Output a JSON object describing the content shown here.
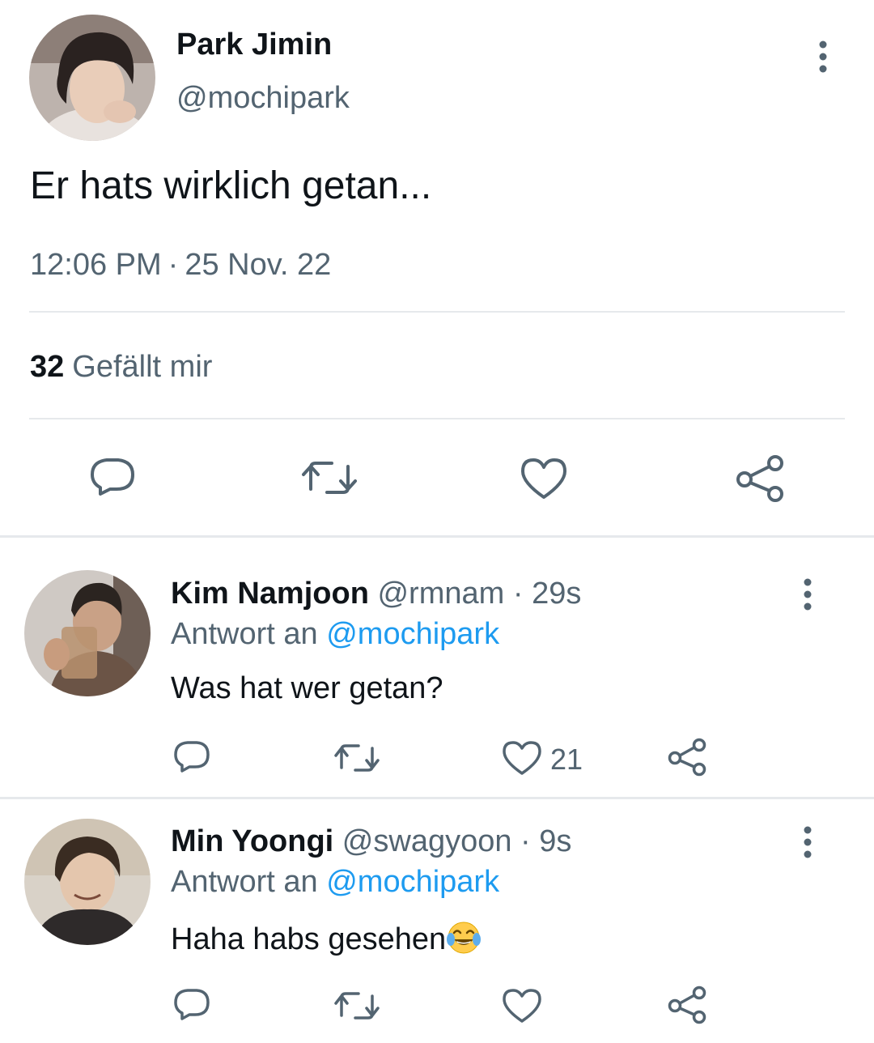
{
  "tweet": {
    "author_name": "Park Jimin",
    "author_handle": "@mochipark",
    "text": "Er hats wirklich getan...",
    "time": "12:06 PM",
    "separator": "·",
    "date": "25 Nov. 22",
    "likes_count": "32",
    "likes_label": "Gefällt mir",
    "actions": [
      "reply-icon",
      "retweet-icon",
      "like-icon",
      "share-icon"
    ]
  },
  "replies": [
    {
      "name": "Kim Namjoon",
      "handle": "@rmnam",
      "sep": "·",
      "time": "29s",
      "reply_prefix": "Antwort an",
      "reply_to": "@mochipark",
      "text": "Was hat wer getan?",
      "likes": "21"
    },
    {
      "name": "Min Yoongi",
      "handle": "@swagyoon",
      "sep": "·",
      "time": "9s",
      "reply_prefix": "Antwort an",
      "reply_to": "@mochipark",
      "text": "Haha habs gesehen",
      "emoji": "face-with-tears-of-joy",
      "likes": ""
    }
  ],
  "colors": {
    "text": "#0f1419",
    "secondary": "#536471",
    "link": "#1d9bf0",
    "divider": "#e6e9ec"
  }
}
